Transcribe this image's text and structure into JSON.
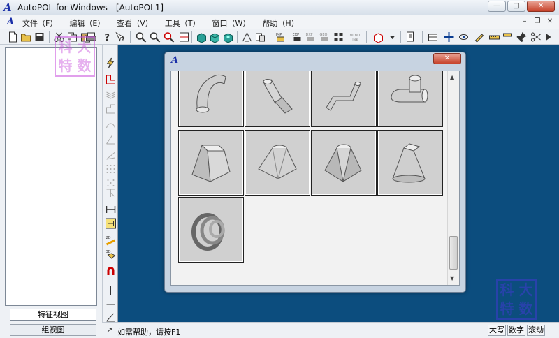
{
  "window": {
    "title": "AutoPOL for Windows - [AutoPOL1]",
    "logo": "A",
    "minimize": "—",
    "maximize": "□",
    "close": "✕"
  },
  "menu": {
    "logo": "A",
    "items": [
      "文件（F）",
      "编辑（E）",
      "查看（V）",
      "工具（T）",
      "窗口（W）",
      "帮助（H）"
    ],
    "mdi_minimize": "–",
    "mdi_restore": "❐",
    "mdi_close": "✕"
  },
  "left_panel": {
    "tab_feature": "特征视图",
    "tab_assembly": "组视图"
  },
  "dialog": {
    "logo": "A",
    "close": "✕",
    "scroll_up": "▲",
    "scroll_down": "▼"
  },
  "statusbar": {
    "icon": "↗",
    "text": "如需帮助，请按F1",
    "caps": "大写",
    "num": "数字",
    "scroll": "滚动"
  },
  "watermark": {
    "chars": [
      "科",
      "大",
      "特",
      "数"
    ]
  },
  "colors": {
    "workspace": "#0c4d7e",
    "accent": "#1a2fa8",
    "close_red": "#c7432b"
  }
}
